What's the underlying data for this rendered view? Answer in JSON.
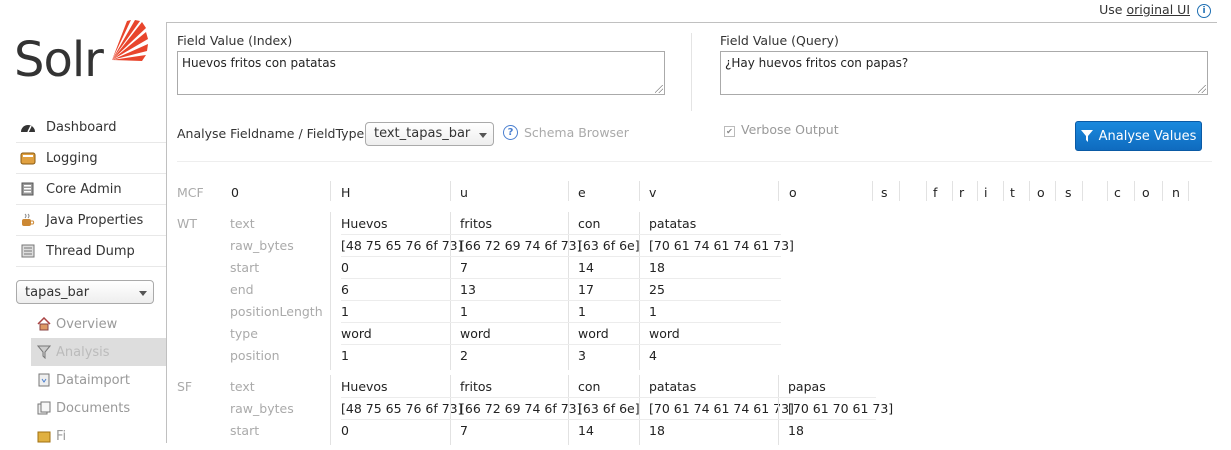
{
  "header": {
    "use_text": "Use",
    "original_ui": "original UI",
    "info_glyph": "i"
  },
  "logo": {
    "word": "Solr",
    "accent": "#e8452c"
  },
  "nav": [
    {
      "label": "Dashboard",
      "icon": "dashboard-icon"
    },
    {
      "label": "Logging",
      "icon": "logging-icon"
    },
    {
      "label": "Core Admin",
      "icon": "core-admin-icon"
    },
    {
      "label": "Java Properties",
      "icon": "java-icon"
    },
    {
      "label": "Thread Dump",
      "icon": "thread-dump-icon"
    }
  ],
  "core": {
    "selected": "tapas_bar"
  },
  "core_menu": [
    {
      "label": "Overview",
      "icon": "home-icon"
    },
    {
      "label": "Analysis",
      "icon": "funnel-icon",
      "active": true
    },
    {
      "label": "Dataimport",
      "icon": "dataimport-icon"
    },
    {
      "label": "Documents",
      "icon": "documents-icon"
    },
    {
      "label": "Fi",
      "icon": "files-icon"
    }
  ],
  "form": {
    "index_label": "Field Value (Index)",
    "index_value": "Huevos fritos con patatas",
    "query_label": "Field Value (Query)",
    "query_value": "¿Hay huevos fritos con papas?",
    "fieldtype_label": "Analyse Fieldname / FieldType:",
    "fieldtype_value": "text_tapas_bar",
    "schema_browser": "Schema Browser",
    "help_glyph": "?",
    "verbose_label": "Verbose Output",
    "verbose_check": "✔",
    "analyse_button": "Analyse Values",
    "accent": "#1a89dd"
  },
  "mcf": {
    "label": "MCF",
    "tokens": [
      "0",
      "H",
      "u",
      "e",
      "v",
      "o",
      "s",
      "",
      "f",
      "r",
      "i",
      "t",
      "o",
      "s",
      "",
      "c",
      "o",
      "n"
    ]
  },
  "wt": {
    "label": "WT",
    "attrs": [
      "text",
      "raw_bytes",
      "start",
      "end",
      "positionLength",
      "type",
      "position"
    ],
    "columns": [
      [
        "Huevos",
        "[48 75 65 76 6f 73]",
        "0",
        "6",
        "1",
        "word",
        "1"
      ],
      [
        "fritos",
        "[66 72 69 74 6f 73]",
        "7",
        "13",
        "1",
        "word",
        "2"
      ],
      [
        "con",
        "[63 6f 6e]",
        "14",
        "17",
        "1",
        "word",
        "3"
      ],
      [
        "patatas",
        "[70 61 74 61 74 61 73]",
        "18",
        "25",
        "1",
        "word",
        "4"
      ]
    ]
  },
  "sf": {
    "label": "SF",
    "attrs": [
      "text",
      "raw_bytes",
      "start"
    ],
    "columns": [
      [
        "Huevos",
        "[48 75 65 76 6f 73]",
        "0"
      ],
      [
        "fritos",
        "[66 72 69 74 6f 73]",
        "7"
      ],
      [
        "con",
        "[63 6f 6e]",
        "14"
      ],
      [
        "patatas",
        "[70 61 74 61 74 61 73]",
        "18"
      ],
      [
        "papas",
        "[70 61 70 61 73]",
        "18"
      ]
    ]
  }
}
